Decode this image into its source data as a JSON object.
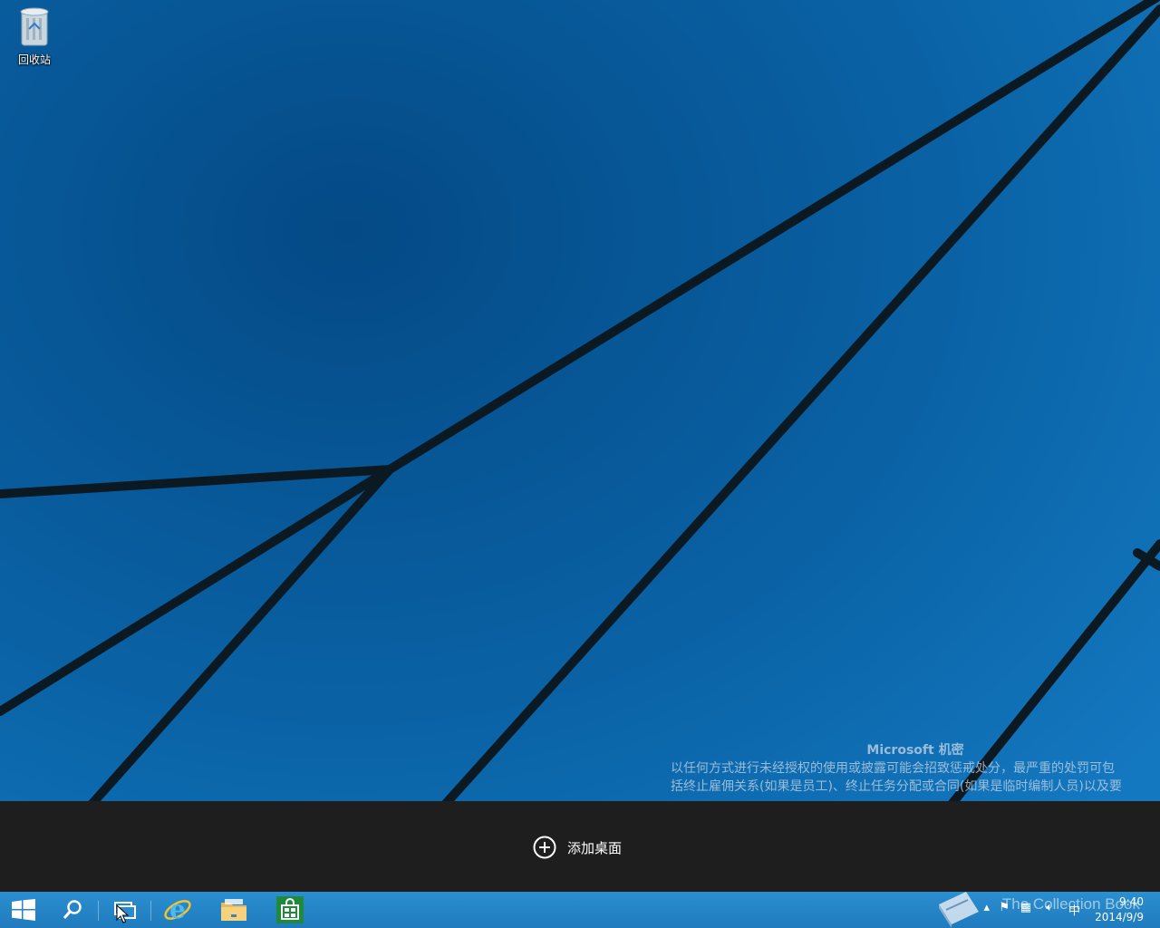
{
  "desktop": {
    "icons": [
      {
        "label": "回收站",
        "icon": "recycle-bin-icon"
      }
    ]
  },
  "watermark": {
    "title": "Microsoft 机密",
    "line1": "以任何方式进行未经授权的使用或披露可能会招致惩戒处分，最严重的处罚可包",
    "line2": "括终止雇佣关系(如果是员工)、终止任务分配或合同(如果是临时编制人员)以及要"
  },
  "task_view": {
    "add_desktop_label": "添加桌面"
  },
  "taskbar": {
    "buttons": [
      {
        "name": "start",
        "icon": "windows-logo-icon"
      },
      {
        "name": "search",
        "icon": "search-icon"
      },
      {
        "name": "task-view",
        "icon": "task-view-icon"
      },
      {
        "name": "internet-explorer",
        "icon": "ie-icon"
      },
      {
        "name": "file-explorer",
        "icon": "folder-icon"
      },
      {
        "name": "store",
        "icon": "store-icon"
      }
    ],
    "tray": {
      "overlay_text": "The Collection Book",
      "ime": "中",
      "time": "9:40",
      "date": "2014/9/9"
    }
  },
  "colors": {
    "wallpaper": "#0a5fa0",
    "taskbar": "#2388c9",
    "task_view_bar": "#1e1e1e",
    "store_green": "#1f8a3a"
  }
}
